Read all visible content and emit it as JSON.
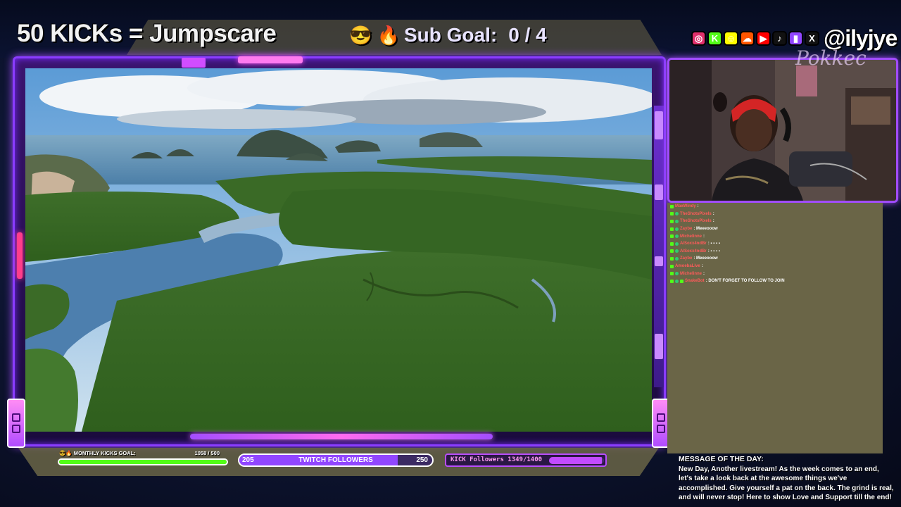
{
  "header": {
    "kicks_title": "50 KICKs = Jumpscare",
    "sub_goal_emojis": "😎 🔥",
    "sub_goal_label": "Sub Goal:",
    "sub_goal_value": "0 / 4"
  },
  "socials": {
    "icons": [
      {
        "name": "instagram-icon",
        "glyph": "◎",
        "color": "#e1306c"
      },
      {
        "name": "kick-icon",
        "glyph": "K",
        "color": "#53fc18"
      },
      {
        "name": "snapchat-icon",
        "glyph": "☺",
        "color": "#fffc00"
      },
      {
        "name": "soundcloud-icon",
        "glyph": "☁",
        "color": "#ff5500"
      },
      {
        "name": "youtube-icon",
        "glyph": "▶",
        "color": "#ff0000"
      },
      {
        "name": "tiktok-icon",
        "glyph": "♪",
        "color": "#111111"
      },
      {
        "name": "twitch-icon",
        "glyph": "▮",
        "color": "#9146ff"
      },
      {
        "name": "x-icon",
        "glyph": "X",
        "color": "#111111"
      }
    ],
    "handle": "@ilyjye"
  },
  "cam_overlay_text": "Pokkec",
  "chat": {
    "lines": [
      {
        "user": "MaxWindy",
        "msg": ":",
        "badges": 1
      },
      {
        "user": "TheShotsPixels",
        "msg": ":",
        "badges": 2
      },
      {
        "user": "TheShotsPixels",
        "msg": ":",
        "badges": 2
      },
      {
        "user": "Zaybe",
        "msg": ": Meeeooow",
        "badges": 2
      },
      {
        "user": "Michelinne",
        "msg": ":",
        "badges": 2
      },
      {
        "user": "AlSoxx4ndBr",
        "msg": ": ▪ ▪ ▪ ▪",
        "badges": 2
      },
      {
        "user": "AlSoxx4ndBr",
        "msg": ": ▪ ▪ ▪ ▪",
        "badges": 2
      },
      {
        "user": "Zaybe",
        "msg": ": Meeeooow",
        "badges": 2
      },
      {
        "user": "AmoebaLive",
        "msg": ":",
        "badges": 1
      },
      {
        "user": "Michelinne",
        "msg": ":",
        "badges": 2
      },
      {
        "user": "SnakeBot",
        "msg": ": DON'T FORGET TO FOLLOW TO JOIN",
        "badges": 3
      }
    ]
  },
  "motd": {
    "title": "MESSAGE OF THE DAY:",
    "body": "New Day, Another livestream! As the week comes to an end, let's take a look back at the awesome things we've accomplished. Give yourself a pat on the back. The grind is real, and will never stop! Here to show Love and Support till the end!"
  },
  "kicks_goal": {
    "label": "MONTHLY KICKS GOAL:",
    "count": "1058 / 500",
    "progress": 1.0
  },
  "twitch_followers": {
    "start": "205",
    "label": "TWITCH FOLLOWERS",
    "end": "250",
    "progress": 0.82
  },
  "kick_followers": {
    "label": "KICK Followers 1349/1400",
    "progress": 0.96
  },
  "colors": {
    "accent_purple": "#9146ff",
    "kick_green": "#53fc18",
    "neon_pink": "#ff6bf0"
  }
}
